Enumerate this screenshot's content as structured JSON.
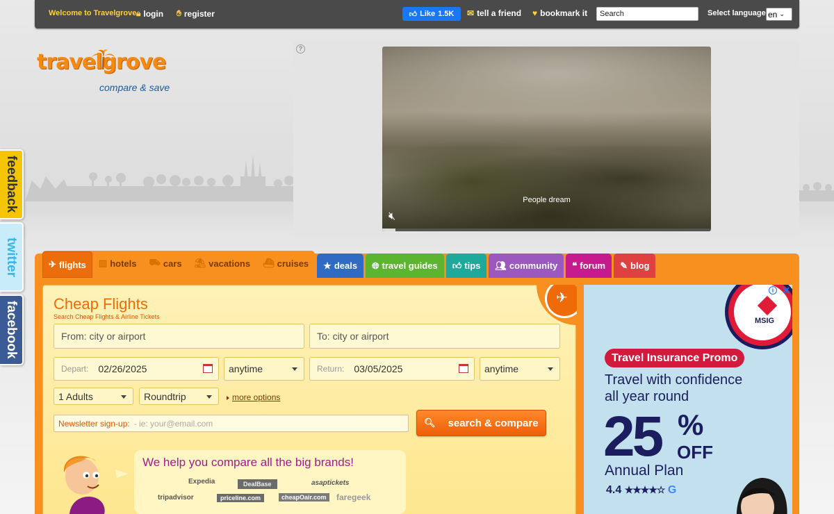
{
  "topbar": {
    "welcome": "Welcome to Travelgrove",
    "login": "login",
    "register": "register",
    "like_label": "Like",
    "like_count": "1.5K",
    "tell_friend": "tell a friend",
    "bookmark": "bookmark it",
    "search_value": "Search",
    "language_label": "Select language:",
    "language_value": "en"
  },
  "logo": {
    "wordmark": "travelgrove",
    "tagline": "compare & save"
  },
  "video": {
    "caption": "People dream",
    "progress": 0.04
  },
  "side_tabs": [
    "feedback",
    "twitter",
    "facebook"
  ],
  "tabs": {
    "orange": [
      {
        "label": "flights",
        "icon": "plane-icon",
        "active": true
      },
      {
        "label": "hotels",
        "icon": "building-icon"
      },
      {
        "label": "cars",
        "icon": "car-icon"
      },
      {
        "label": "vacations",
        "icon": "palm-icon"
      },
      {
        "label": "cruises",
        "icon": "ship-icon"
      }
    ],
    "colored": [
      {
        "label": "deals",
        "icon": "star-icon",
        "color": "#2f6bc3"
      },
      {
        "label": "travel guides",
        "icon": "globe-icon",
        "color": "#5bb531"
      },
      {
        "label": "tips",
        "icon": "thumb-icon",
        "color": "#1fa99b"
      },
      {
        "label": "community",
        "icon": "people-icon",
        "color": "#9b59c0"
      },
      {
        "label": "forum",
        "icon": "chat-icon",
        "color": "#c51b8f"
      },
      {
        "label": "blog",
        "icon": "pencil-icon",
        "color": "#de4140"
      }
    ]
  },
  "search": {
    "title": "Cheap Flights",
    "subtitle": "Search Cheap Flights & Airline Tickets",
    "from_placeholder": "From: city or airport",
    "to_placeholder": "To: city or airport",
    "depart_label": "Depart:",
    "depart_value": "02/26/2025",
    "depart_time": "anytime",
    "return_label": "Return:",
    "return_value": "03/05/2025",
    "return_time": "anytime",
    "travelers": "1 Adults",
    "trip_type": "Roundtrip",
    "more_options": "more options",
    "newsletter_label": "Newsletter sign-up:",
    "newsletter_placeholder": "- ie: your@email.com",
    "search_button": "search & compare"
  },
  "brands": {
    "headline": "We help you compare all the big brands!",
    "logos": [
      "Expedia",
      "DealBase",
      "asaptickets",
      "tripadvisor",
      "priceline.com",
      "cheapOair.com",
      "faregeek"
    ]
  },
  "ad": {
    "brand": "MSIG",
    "pill": "Travel Insurance Promo",
    "line1": "Travel with confidence",
    "line2": "all year round",
    "percent": "25",
    "percent_sign": "%",
    "off": "OFF",
    "plan": "Annual Plan",
    "rating": "4.4",
    "stars": 4.4,
    "accent": "#d21a3c",
    "navy": "#1b1d5e"
  }
}
